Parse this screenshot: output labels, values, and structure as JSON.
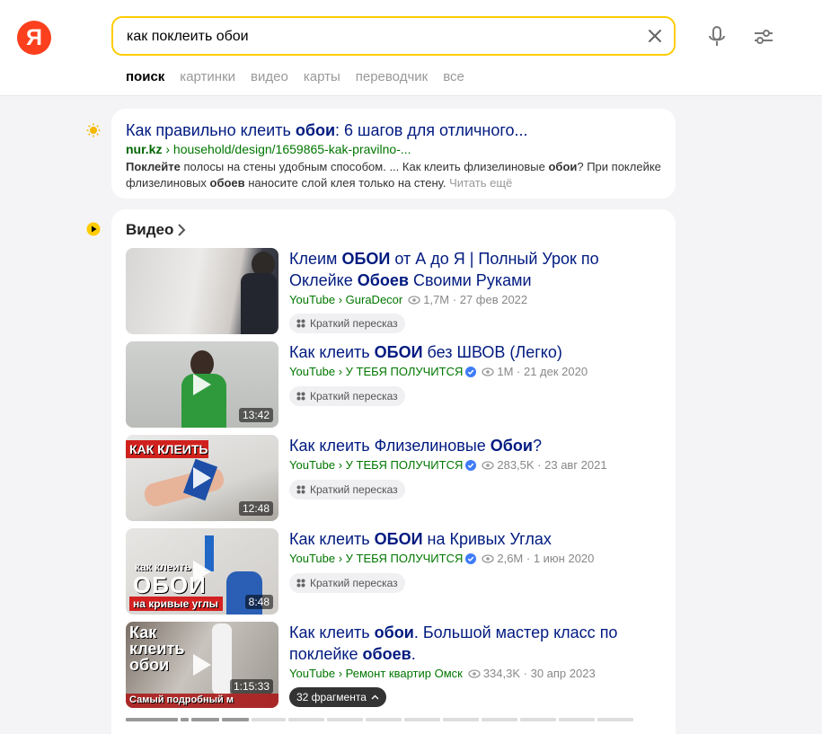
{
  "header": {
    "logo_text": "Я",
    "search_value": "как поклеить обои",
    "tabs": [
      {
        "label": "поиск",
        "active": true
      },
      {
        "label": "картинки",
        "active": false
      },
      {
        "label": "видео",
        "active": false
      },
      {
        "label": "карты",
        "active": false
      },
      {
        "label": "переводчик",
        "active": false
      },
      {
        "label": "все",
        "active": false
      }
    ],
    "colors": {
      "logo": "#fc3f1d",
      "search_border": "#ffcc00"
    }
  },
  "result1": {
    "title_pre": "Как правильно клеить ",
    "title_bold": "обои",
    "title_post": ": 6 шагов для отличного...",
    "url_domain": "nur.kz",
    "url_path": " › household/design/1659865-kak-pravilno-...",
    "snippet_b1": "Поклейте",
    "snippet_t1": " полосы на стены удобным способом. ... Как клеить флизелиновые ",
    "snippet_b2": "обои",
    "snippet_t2": "? При поклейке флизелиновых ",
    "snippet_b3": "обоев",
    "snippet_t3": " наносите слой клея только на стену.",
    "more_label": " Читать ещё"
  },
  "video_block": {
    "header": "Видео",
    "items": [
      {
        "title_parts": [
          {
            "t": "Клеим "
          },
          {
            "b": "ОБОИ"
          },
          {
            "t": " от А до Я | Полный Урок по Оклейке "
          },
          {
            "b": "Обоев"
          },
          {
            "t": " Своими Руками"
          }
        ],
        "source": "YouTube",
        "channel": "GuraDecor",
        "verified": false,
        "views": "1,7M",
        "date": "27 фев 2022",
        "duration": "",
        "chip": "Краткий пересказ"
      },
      {
        "title_parts": [
          {
            "t": "Как клеить "
          },
          {
            "b": "ОБОИ"
          },
          {
            "t": " без ШВОВ (Легко)"
          }
        ],
        "source": "YouTube",
        "channel": "У ТЕБЯ ПОЛУЧИТСЯ",
        "verified": true,
        "views": "1M",
        "date": "21 дек 2020",
        "duration": "13:42",
        "chip": "Краткий пересказ"
      },
      {
        "title_parts": [
          {
            "t": "Как клеить Флизелиновые "
          },
          {
            "b": "Обои"
          },
          {
            "t": "?"
          }
        ],
        "source": "YouTube",
        "channel": "У ТЕБЯ ПОЛУЧИТСЯ",
        "verified": true,
        "views": "283,5K",
        "date": "23 авг 2021",
        "duration": "12:48",
        "chip": "Краткий пересказ",
        "thumb_text": "КАК КЛЕИТЬ"
      },
      {
        "title_parts": [
          {
            "t": "Как клеить "
          },
          {
            "b": "ОБОИ"
          },
          {
            "t": " на Кривых Углах"
          }
        ],
        "source": "YouTube",
        "channel": "У ТЕБЯ ПОЛУЧИТСЯ",
        "verified": true,
        "views": "2,6M",
        "date": "1 июн 2020",
        "duration": "8:48",
        "chip": "Краткий пересказ",
        "thumb_text_1": "как клеить",
        "thumb_text_2": "ОБОИ",
        "thumb_text_3": "на кривые углы"
      },
      {
        "title_parts": [
          {
            "t": "Как клеить "
          },
          {
            "b": "обои"
          },
          {
            "t": ". Большой мастер класс по поклейке "
          },
          {
            "b": "обоев"
          },
          {
            "t": "."
          }
        ],
        "source": "YouTube",
        "channel": "Ремонт квартир Омск",
        "verified": false,
        "views": "334,3K",
        "date": "30 апр 2023",
        "duration": "1:15:33",
        "chip": "32 фрагмента",
        "thumb_text_1": "Как",
        "thumb_text_2": "клеить",
        "thumb_text_3": "обои",
        "thumb_text_4": "Самый подробный м"
      }
    ]
  }
}
